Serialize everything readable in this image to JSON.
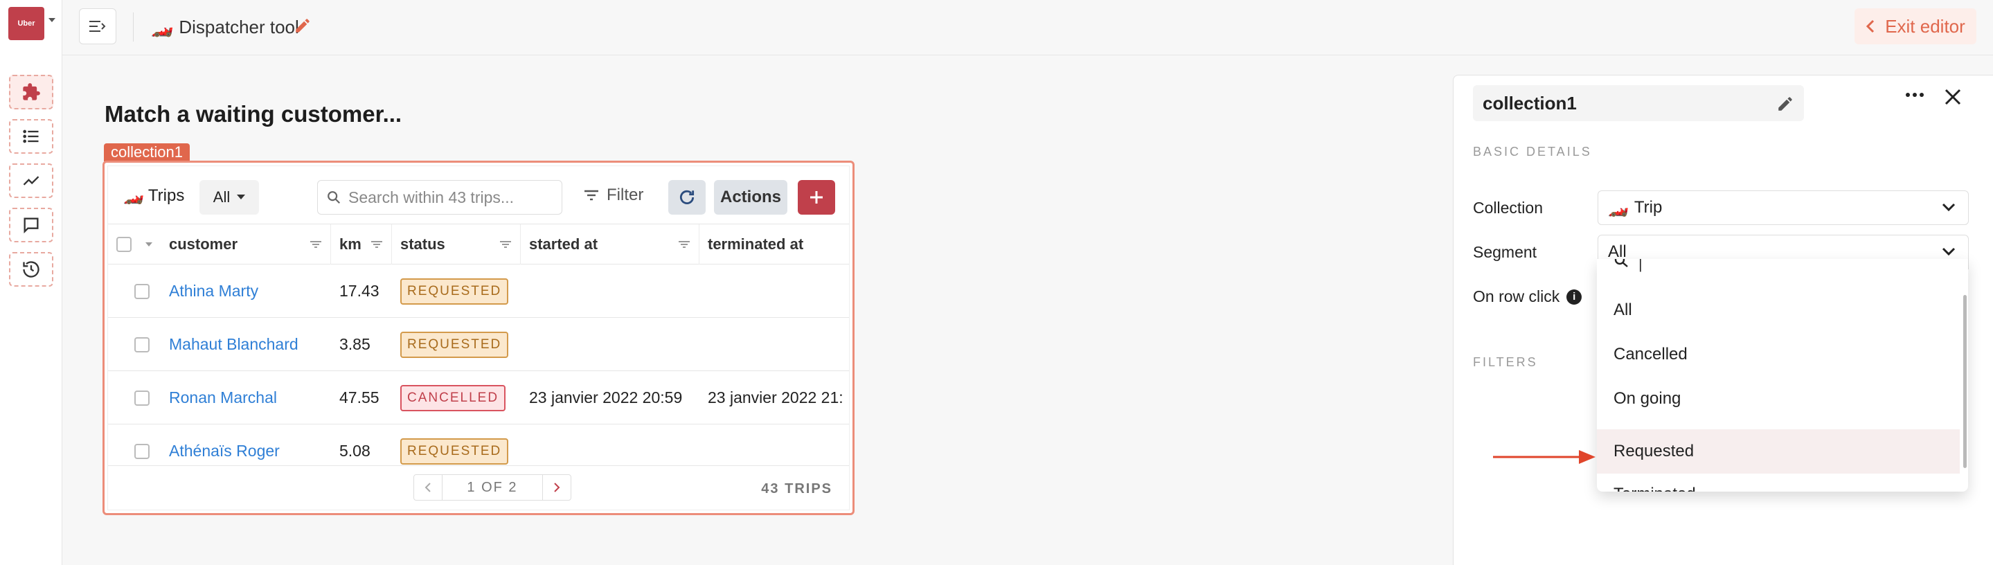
{
  "sidebar": {
    "logo_text": "Uber",
    "items": [
      {
        "icon": "puzzle-icon",
        "active": true
      },
      {
        "icon": "list-icon",
        "active": false
      },
      {
        "icon": "chart-line-icon",
        "active": false
      },
      {
        "icon": "chat-icon",
        "active": false
      },
      {
        "icon": "history-icon",
        "active": false
      }
    ]
  },
  "topbar": {
    "app_emoji": "🏎️",
    "app_title": "Dispatcher tool",
    "exit_label": "Exit editor"
  },
  "canvas": {
    "heading": "Match a waiting customer...",
    "collection_tag": "collection1"
  },
  "table": {
    "collection_emoji": "🏎️",
    "collection_label": "Trips",
    "segment_value": "All",
    "search_placeholder": "Search within 43 trips...",
    "filter_label": "Filter",
    "actions_label": "Actions",
    "columns": [
      "customer",
      "km",
      "status",
      "started at",
      "terminated at"
    ],
    "rows": [
      {
        "customer": "Athina Marty",
        "km": "17.43",
        "status": "REQUESTED",
        "status_kind": "req",
        "started_at": "",
        "terminated_at": ""
      },
      {
        "customer": "Mahaut Blanchard",
        "km": "3.85",
        "status": "REQUESTED",
        "status_kind": "req",
        "started_at": "",
        "terminated_at": ""
      },
      {
        "customer": "Ronan Marchal",
        "km": "47.55",
        "status": "CANCELLED",
        "status_kind": "can",
        "started_at": "23 janvier 2022 20:59",
        "terminated_at": "23 janvier 2022 21:"
      },
      {
        "customer": "Athénaïs Roger",
        "km": "5.08",
        "status": "REQUESTED",
        "status_kind": "req",
        "started_at": "",
        "terminated_at": ""
      }
    ],
    "pager_text": "1 OF 2",
    "count_text": "43 TRIPS"
  },
  "panel": {
    "name": "collection1",
    "section_basic": "BASIC DETAILS",
    "collection_label": "Collection",
    "collection_value_emoji": "🏎️",
    "collection_value": "Trip",
    "segment_label": "Segment",
    "segment_value": "All",
    "row_click_label": "On row click",
    "section_filters": "FILTERS"
  },
  "dropdown": {
    "search_value": "|",
    "options": [
      "All",
      "Cancelled",
      "On going",
      "Requested",
      "Terminated"
    ],
    "highlighted": "Requested"
  },
  "colors": {
    "accent": "#c0404b",
    "editor_orange": "#e0674c",
    "link": "#2f7fd6"
  }
}
